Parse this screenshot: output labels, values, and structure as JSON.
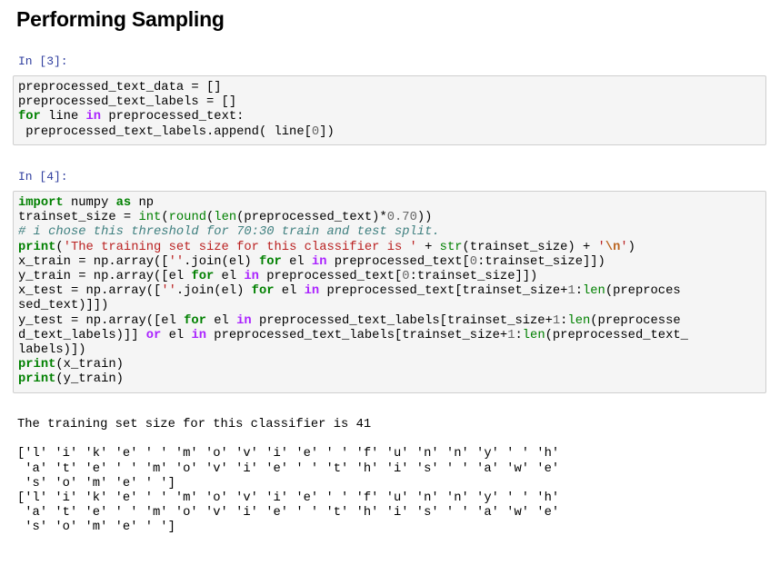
{
  "heading": "Performing Sampling",
  "cells": [
    {
      "prompt": "In [3]:",
      "lines": [
        [
          [
            "preprocessed_text_data = []",
            ""
          ]
        ],
        [
          [
            "preprocessed_text_labels = []",
            ""
          ]
        ],
        [
          [
            "for",
            "kw"
          ],
          [
            " line ",
            ""
          ],
          [
            "in",
            "op"
          ],
          [
            " preprocessed_text:",
            ""
          ]
        ],
        [
          [
            " preprocessed_text_labels.append( line[",
            ""
          ],
          [
            "0",
            "nu"
          ],
          [
            "])",
            ""
          ]
        ]
      ]
    },
    {
      "prompt": "In [4]:",
      "lines": [
        [
          [
            "import",
            "kw"
          ],
          [
            " numpy ",
            ""
          ],
          [
            "as",
            "kw"
          ],
          [
            " np",
            ""
          ]
        ],
        [
          [
            "trainset_size = ",
            ""
          ],
          [
            "int",
            "bi"
          ],
          [
            "(",
            ""
          ],
          [
            "round",
            "bi"
          ],
          [
            "(",
            ""
          ],
          [
            "len",
            "bi"
          ],
          [
            "(preprocessed_text)",
            ""
          ],
          [
            "*",
            ""
          ],
          [
            "0.70",
            "nu"
          ],
          [
            "))",
            ""
          ]
        ],
        [
          [
            "# i chose this threshold for 70:30 train and test split.",
            "cm"
          ]
        ],
        [
          [
            "print",
            "kw"
          ],
          [
            "(",
            ""
          ],
          [
            "'The training set size for this classifier is '",
            "st"
          ],
          [
            " + ",
            ""
          ],
          [
            "str",
            "bi"
          ],
          [
            "(trainset_size) + ",
            ""
          ],
          [
            "'",
            "st"
          ],
          [
            "\\n",
            "esc"
          ],
          [
            "'",
            "st"
          ],
          [
            ")",
            ""
          ]
        ],
        [
          [
            "x_train = np.array([",
            ""
          ],
          [
            "''",
            "st"
          ],
          [
            ".join(el) ",
            ""
          ],
          [
            "for",
            "kw"
          ],
          [
            " el ",
            ""
          ],
          [
            "in",
            "op"
          ],
          [
            " preprocessed_text[",
            ""
          ],
          [
            "0",
            "nu"
          ],
          [
            ":trainset_size]])",
            ""
          ]
        ],
        [
          [
            "y_train = np.array([el ",
            ""
          ],
          [
            "for",
            "kw"
          ],
          [
            " el ",
            ""
          ],
          [
            "in",
            "op"
          ],
          [
            " preprocessed_text[",
            ""
          ],
          [
            "0",
            "nu"
          ],
          [
            ":trainset_size]])",
            ""
          ]
        ],
        [
          [
            "x_test = np.array([",
            ""
          ],
          [
            "''",
            "st"
          ],
          [
            ".join(el) ",
            ""
          ],
          [
            "for",
            "kw"
          ],
          [
            " el ",
            ""
          ],
          [
            "in",
            "op"
          ],
          [
            " preprocessed_text[trainset_size+",
            ""
          ],
          [
            "1",
            "nu"
          ],
          [
            ":",
            ""
          ],
          [
            "len",
            "bi"
          ],
          [
            "(preproces",
            ""
          ]
        ],
        [
          [
            "sed_text)]])",
            ""
          ]
        ],
        [
          [
            "y_test = np.array([el ",
            ""
          ],
          [
            "for",
            "kw"
          ],
          [
            " el ",
            ""
          ],
          [
            "in",
            "op"
          ],
          [
            " preprocessed_text_labels[trainset_size+",
            ""
          ],
          [
            "1",
            "nu"
          ],
          [
            ":",
            ""
          ],
          [
            "len",
            "bi"
          ],
          [
            "(preprocesse",
            ""
          ]
        ],
        [
          [
            "d_text_labels)]] ",
            ""
          ],
          [
            "or",
            "op"
          ],
          [
            " el ",
            ""
          ],
          [
            "in",
            "op"
          ],
          [
            " preprocessed_text_labels[trainset_size+",
            ""
          ],
          [
            "1",
            "nu"
          ],
          [
            ":",
            ""
          ],
          [
            "len",
            "bi"
          ],
          [
            "(preprocessed_text_",
            ""
          ]
        ],
        [
          [
            "labels)])",
            ""
          ]
        ],
        [
          [
            "print",
            "kw"
          ],
          [
            "(x_train)",
            ""
          ]
        ],
        [
          [
            "print",
            "kw"
          ],
          [
            "(y_train)",
            ""
          ]
        ]
      ],
      "output": [
        "The training set size for this classifier is 41",
        "",
        "['l' 'i' 'k' 'e' ' ' 'm' 'o' 'v' 'i' 'e' ' ' 'f' 'u' 'n' 'n' 'y' ' ' 'h'",
        " 'a' 't' 'e' ' ' 'm' 'o' 'v' 'i' 'e' ' ' 't' 'h' 'i' 's' ' ' 'a' 'w' 'e'",
        " 's' 'o' 'm' 'e' ' ']",
        "['l' 'i' 'k' 'e' ' ' 'm' 'o' 'v' 'i' 'e' ' ' 'f' 'u' 'n' 'n' 'y' ' ' 'h'",
        " 'a' 't' 'e' ' ' 'm' 'o' 'v' 'i' 'e' ' ' 't' 'h' 'i' 's' ' ' 'a' 'w' 'e'",
        " 's' 'o' 'm' 'e' ' ']"
      ]
    }
  ]
}
